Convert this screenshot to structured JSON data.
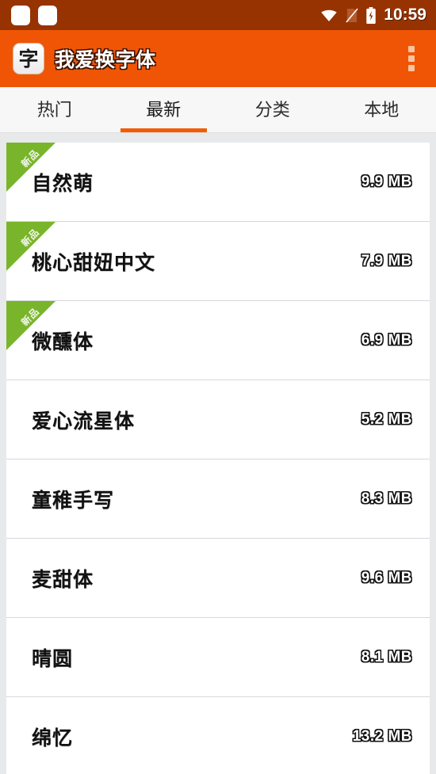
{
  "statusbar": {
    "time": "10:59",
    "icons": [
      "notification-placeholder",
      "notification-placeholder",
      "wifi-icon",
      "no-sim-icon",
      "battery-charging-icon"
    ]
  },
  "appbar": {
    "logo_char": "字",
    "title": "我爱换字体",
    "overflow_label": "更多"
  },
  "tabs": [
    {
      "label": "热门",
      "active": false
    },
    {
      "label": "最新",
      "active": true
    },
    {
      "label": "分类",
      "active": false
    },
    {
      "label": "本地",
      "active": false
    }
  ],
  "badge_label": "新品",
  "fonts": [
    {
      "name": "自然萌",
      "size": "9.9 MB",
      "is_new": true
    },
    {
      "name": "桃心甜妞中文",
      "size": "7.9 MB",
      "is_new": true
    },
    {
      "name": "微醺体",
      "size": "6.9 MB",
      "is_new": true
    },
    {
      "name": "爱心流星体",
      "size": "5.2 MB",
      "is_new": false
    },
    {
      "name": "童稚手写",
      "size": "8.3 MB",
      "is_new": false
    },
    {
      "name": "麦甜体",
      "size": "9.6 MB",
      "is_new": false
    },
    {
      "name": "晴圆",
      "size": "8.1 MB",
      "is_new": false
    },
    {
      "name": "绵忆",
      "size": "13.2 MB",
      "is_new": false
    }
  ],
  "colors": {
    "statusbar": "#963300",
    "appbar": "#f05505",
    "accent": "#f25c05",
    "badge_green": "#79b52b",
    "page_bg": "#e8e9eb",
    "card_bg": "#ffffff"
  }
}
